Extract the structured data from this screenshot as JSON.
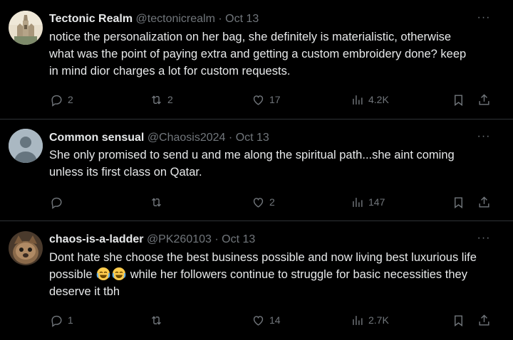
{
  "tweets": [
    {
      "name": "Tectonic Realm",
      "handle": "@tectonicrealm",
      "dot": "·",
      "date": "Oct 13",
      "text": "notice the personalization on her bag, she definitely is materialistic, otherwise what was the point of paying extra and getting a custom embroidery done? keep in mind dior charges a lot for custom requests.",
      "replies": "2",
      "reposts": "2",
      "likes": "17",
      "views": "4.2K"
    },
    {
      "name": "Common sensual",
      "handle": "@Chaosis2024",
      "dot": "·",
      "date": "Oct 13",
      "text": "She only promised to send u and me along the spiritual path...she aint coming unless its first class on Qatar.",
      "replies": "",
      "reposts": "",
      "likes": "2",
      "views": "147"
    },
    {
      "name": "chaos-is-a-ladder",
      "handle": "@PK260103",
      "dot": "·",
      "date": "Oct 13",
      "text_before": "Dont hate she choose the best business possible and now living best luxurious life possible ",
      "text_after": " while her followers continue to struggle for basic necessities they deserve it tbh",
      "replies": "1",
      "reposts": "",
      "likes": "14",
      "views": "2.7K"
    }
  ],
  "more_symbol": "···",
  "colors": {
    "background": "#000000",
    "text": "#e7e9ea",
    "muted": "#71767b",
    "divider": "#2f3336"
  },
  "icons": [
    "reply-icon",
    "repost-icon",
    "like-icon",
    "views-icon",
    "bookmark-icon",
    "share-icon",
    "more-icon",
    "joy-emoji"
  ]
}
